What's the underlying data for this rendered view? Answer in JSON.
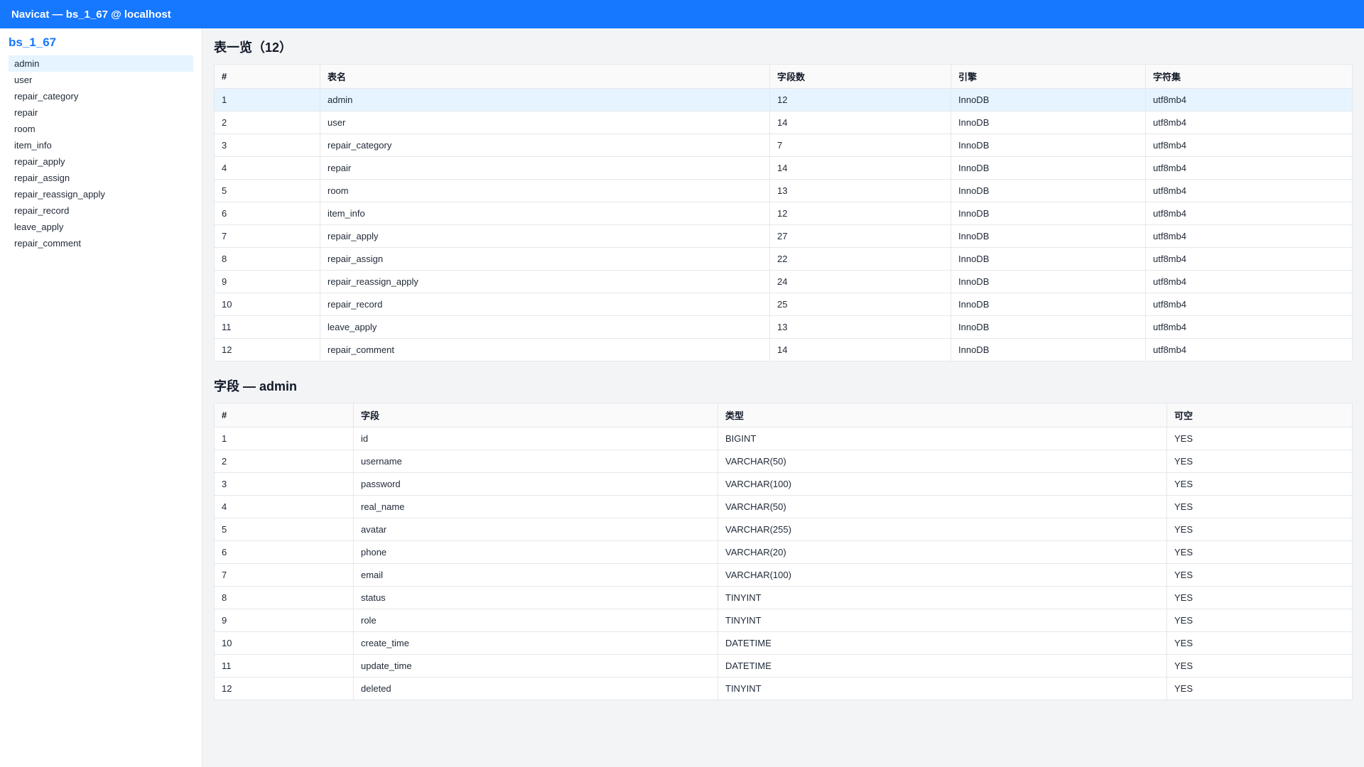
{
  "window": {
    "title": "Navicat — bs_1_67 @ localhost"
  },
  "sidebar": {
    "db_name": "bs_1_67",
    "items": [
      {
        "label": "admin"
      },
      {
        "label": "user"
      },
      {
        "label": "repair_category"
      },
      {
        "label": "repair"
      },
      {
        "label": "room"
      },
      {
        "label": "item_info"
      },
      {
        "label": "repair_apply"
      },
      {
        "label": "repair_assign"
      },
      {
        "label": "repair_reassign_apply"
      },
      {
        "label": "repair_record"
      },
      {
        "label": "leave_apply"
      },
      {
        "label": "repair_comment"
      }
    ],
    "selected": "admin"
  },
  "tables_section": {
    "title": "表一览（12）",
    "headers": [
      "#",
      "表名",
      "字段数",
      "引擎",
      "字符集"
    ],
    "rows": [
      [
        "1",
        "admin",
        "12",
        "InnoDB",
        "utf8mb4"
      ],
      [
        "2",
        "user",
        "14",
        "InnoDB",
        "utf8mb4"
      ],
      [
        "3",
        "repair_category",
        "7",
        "InnoDB",
        "utf8mb4"
      ],
      [
        "4",
        "repair",
        "14",
        "InnoDB",
        "utf8mb4"
      ],
      [
        "5",
        "room",
        "13",
        "InnoDB",
        "utf8mb4"
      ],
      [
        "6",
        "item_info",
        "12",
        "InnoDB",
        "utf8mb4"
      ],
      [
        "7",
        "repair_apply",
        "27",
        "InnoDB",
        "utf8mb4"
      ],
      [
        "8",
        "repair_assign",
        "22",
        "InnoDB",
        "utf8mb4"
      ],
      [
        "9",
        "repair_reassign_apply",
        "24",
        "InnoDB",
        "utf8mb4"
      ],
      [
        "10",
        "repair_record",
        "25",
        "InnoDB",
        "utf8mb4"
      ],
      [
        "11",
        "leave_apply",
        "13",
        "InnoDB",
        "utf8mb4"
      ],
      [
        "12",
        "repair_comment",
        "14",
        "InnoDB",
        "utf8mb4"
      ]
    ]
  },
  "fields_section": {
    "title": "字段 — admin",
    "headers": [
      "#",
      "字段",
      "类型",
      "可空"
    ],
    "rows": [
      [
        "1",
        "id",
        "BIGINT",
        "YES"
      ],
      [
        "2",
        "username",
        "VARCHAR(50)",
        "YES"
      ],
      [
        "3",
        "password",
        "VARCHAR(100)",
        "YES"
      ],
      [
        "4",
        "real_name",
        "VARCHAR(50)",
        "YES"
      ],
      [
        "5",
        "avatar",
        "VARCHAR(255)",
        "YES"
      ],
      [
        "6",
        "phone",
        "VARCHAR(20)",
        "YES"
      ],
      [
        "7",
        "email",
        "VARCHAR(100)",
        "YES"
      ],
      [
        "8",
        "status",
        "TINYINT",
        "YES"
      ],
      [
        "9",
        "role",
        "TINYINT",
        "YES"
      ],
      [
        "10",
        "create_time",
        "DATETIME",
        "YES"
      ],
      [
        "11",
        "update_time",
        "DATETIME",
        "YES"
      ],
      [
        "12",
        "deleted",
        "TINYINT",
        "YES"
      ]
    ]
  },
  "colors": {
    "accent": "#1677ff",
    "selected_bg": "#e6f4ff"
  }
}
